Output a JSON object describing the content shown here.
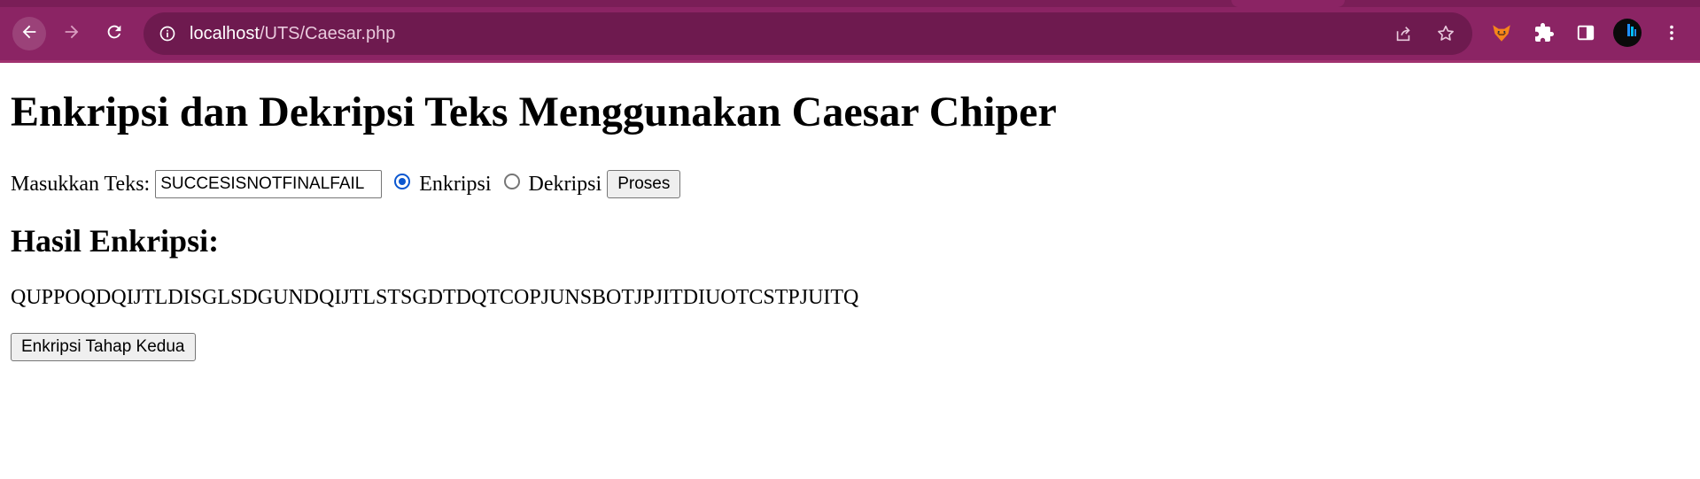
{
  "browser": {
    "url_host": "localhost",
    "url_path": "/UTS/Caesar.php",
    "colors": {
      "frame": "#8b2464",
      "omnibox": "#6e1a4f"
    }
  },
  "icons": {
    "back": "arrow-left-icon",
    "forward": "arrow-right-icon",
    "reload": "reload-icon",
    "site_info": "info-icon",
    "share": "share-icon",
    "bookmark": "star-icon",
    "extension_fox": "fox-extension-icon",
    "extensions": "puzzle-icon",
    "side_panel": "side-panel-icon",
    "profile": "avatar",
    "menu": "kebab-menu-icon"
  },
  "page": {
    "title": "Enkripsi dan Dekripsi Teks Menggunakan Caesar Chiper",
    "form": {
      "label": "Masukkan Teks:",
      "input_value": "SUCCESISNOTFINALFAIL",
      "options": [
        {
          "label": "Enkripsi",
          "selected": true
        },
        {
          "label": "Dekripsi",
          "selected": false
        }
      ],
      "submit_label": "Proses"
    },
    "result": {
      "heading": "Hasil Enkripsi:",
      "text": "QUPPOQDQIJTLDISGLSDGUNDQIJTLSTSGDTDQTCOPJUNSBOTJPJITDIUOTCSTPJUITQ"
    },
    "second_stage_label": "Enkripsi Tahap Kedua",
    "accent_color": "#0b57d0"
  }
}
